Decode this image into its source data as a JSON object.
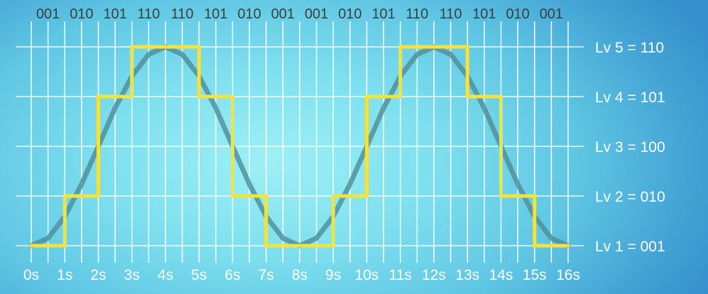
{
  "chart_data": {
    "type": "line",
    "title": "",
    "xlabel": "",
    "ylabel": "",
    "x_ticks": [
      "0s",
      "1s",
      "2s",
      "3s",
      "4s",
      "5s",
      "6s",
      "7s",
      "8s",
      "9s",
      "10s",
      "11s",
      "12s",
      "13s",
      "14s",
      "15s",
      "16s"
    ],
    "xlim": [
      0,
      16
    ],
    "ylim": [
      1,
      5
    ],
    "grid": true,
    "y_levels": [
      {
        "level": 5,
        "label": "Lv 5 = 110"
      },
      {
        "level": 4,
        "label": "Lv 4 = 101"
      },
      {
        "level": 3,
        "label": "Lv 3 = 100"
      },
      {
        "level": 2,
        "label": "Lv 2 = 010"
      },
      {
        "level": 1,
        "label": "Lv 1 = 001"
      }
    ],
    "sample_codes": [
      "001",
      "010",
      "101",
      "110",
      "110",
      "101",
      "010",
      "001",
      "001",
      "010",
      "101",
      "110",
      "110",
      "101",
      "010",
      "001"
    ],
    "series": [
      {
        "kind": "smooth",
        "color": "#4f8f98",
        "x": [
          0,
          0.5,
          1,
          1.5,
          2,
          2.5,
          3,
          3.5,
          4,
          4.5,
          5,
          5.5,
          6,
          6.5,
          7,
          7.5,
          8,
          8.5,
          9,
          9.5,
          10,
          10.5,
          11,
          11.5,
          12,
          12.5,
          13,
          13.5,
          14,
          14.5,
          15,
          15.5,
          16
        ],
        "y": [
          1.0,
          1.15,
          1.59,
          2.24,
          3.0,
          3.77,
          4.41,
          4.85,
          5.0,
          4.85,
          4.41,
          3.77,
          3.0,
          2.24,
          1.59,
          1.15,
          1.0,
          1.15,
          1.59,
          2.24,
          3.0,
          3.77,
          4.41,
          4.85,
          5.0,
          4.85,
          4.41,
          3.77,
          3.0,
          2.24,
          1.59,
          1.15,
          1.0
        ]
      },
      {
        "kind": "step",
        "color": "#f3e33f",
        "values": [
          1,
          2,
          4,
          5,
          5,
          4,
          2,
          1,
          1,
          2,
          4,
          5,
          5,
          4,
          2,
          1
        ]
      }
    ]
  }
}
